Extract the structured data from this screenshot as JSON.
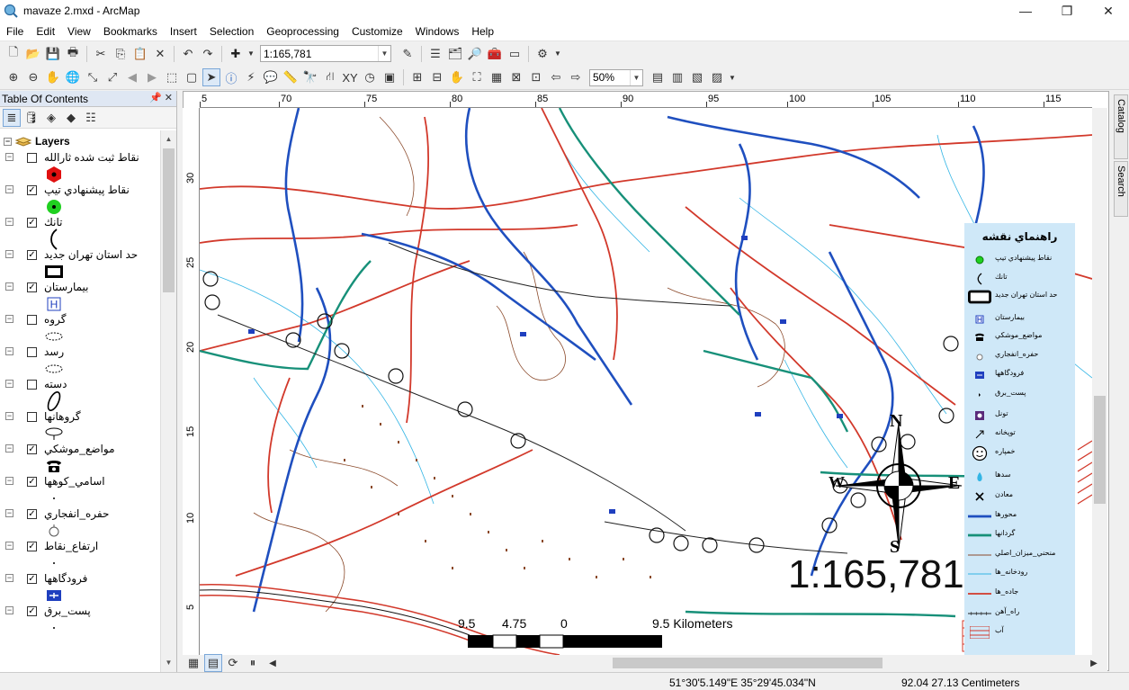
{
  "window": {
    "title": "mavaze 2.mxd - ArcMap",
    "minimize": "—",
    "maximize": "❐",
    "close": "✕"
  },
  "menu": [
    "File",
    "Edit",
    "View",
    "Bookmarks",
    "Insert",
    "Selection",
    "Geoprocessing",
    "Customize",
    "Windows",
    "Help"
  ],
  "toolbar": {
    "scale_value": "1:165,781",
    "zoom_value": "50%"
  },
  "toc": {
    "title": "Table Of Contents",
    "root": "Layers",
    "layers": [
      {
        "name": "نقاط ثبت شده ثارالله",
        "checked": false,
        "symbol": "red-hexagon"
      },
      {
        "name": "نقاط پيشنهادي تيپ",
        "checked": true,
        "symbol": "green-dot"
      },
      {
        "name": "تانك",
        "checked": true,
        "symbol": "paren"
      },
      {
        "name": "حد استان تهران جديد",
        "checked": true,
        "symbol": "black-rect"
      },
      {
        "name": "بيمارستان",
        "checked": true,
        "symbol": "hospital-h"
      },
      {
        "name": "گروه",
        "checked": false,
        "symbol": "ellipse-dashed"
      },
      {
        "name": "رسد",
        "checked": false,
        "symbol": "ellipse-dashed"
      },
      {
        "name": "دسته",
        "checked": false,
        "symbol": "ellipse-tilt"
      },
      {
        "name": "گروهانها",
        "checked": false,
        "symbol": "ellipse-tail"
      },
      {
        "name": "مواضع_موشكي",
        "checked": true,
        "symbol": "phone"
      },
      {
        "name": "اسامي_كوهها",
        "checked": true,
        "symbol": "dot"
      },
      {
        "name": "حفره_انفجاري",
        "checked": true,
        "symbol": "circle-small"
      },
      {
        "name": "ارتفاع_نقاط",
        "checked": true,
        "symbol": "dot"
      },
      {
        "name": "فرودگاهها",
        "checked": true,
        "symbol": "airport"
      },
      {
        "name": "پست_برق",
        "checked": true,
        "symbol": "dot"
      }
    ]
  },
  "ruler": {
    "top": [
      "5",
      "70",
      "75",
      "80",
      "85",
      "90",
      "95",
      "100",
      "105",
      "110",
      "115"
    ],
    "left": [
      "30",
      "25",
      "20",
      "15",
      "10",
      "5"
    ]
  },
  "map": {
    "scale_text": "1:165,781",
    "scalebar_labels": [
      "9.5",
      "4.75",
      "0",
      "9.5 Kilometers"
    ],
    "compass": {
      "n": "N",
      "s": "S",
      "e": "E",
      "w": "W"
    }
  },
  "legend": {
    "title": "راهنماي نقشه",
    "items": [
      {
        "label": "نقاط پيشنهادي تيپ",
        "symbol": "green-dot"
      },
      {
        "label": "تانك",
        "symbol": "paren"
      },
      {
        "label": "حد استان تهران جديد",
        "symbol": "black-rect"
      },
      {
        "label": "بيمارستان",
        "symbol": "blue-h"
      },
      {
        "label": "مواضع_موشكي",
        "symbol": "phone"
      },
      {
        "label": "حفره_انفجاري",
        "symbol": "circle-small"
      },
      {
        "label": "فرودگاهها",
        "symbol": "airport"
      },
      {
        "label": "پست_برق",
        "symbol": "dot"
      },
      {
        "label": "تونل",
        "symbol": "tunnel"
      },
      {
        "label": "توپخانه",
        "symbol": "arrow"
      },
      {
        "label": "خمپاره",
        "symbol": "smiley"
      },
      {
        "label": "سدها",
        "symbol": "dam"
      },
      {
        "label": "معادن",
        "symbol": "mine"
      },
      {
        "label": "محورها",
        "symbol": "line-blue"
      },
      {
        "label": "گردانها",
        "symbol": "line-teal"
      },
      {
        "label": "منحني_ميزان_اصلي",
        "symbol": "line-brown"
      },
      {
        "label": "رودخانه_ها",
        "symbol": "line-cyan"
      },
      {
        "label": "جاده_ها",
        "symbol": "line-red"
      },
      {
        "label": "راه_آهن",
        "symbol": "line-rail"
      },
      {
        "label": "آب",
        "symbol": "hatch"
      }
    ]
  },
  "sidebar_tabs": [
    "Catalog",
    "Search"
  ],
  "status": {
    "coords": "51°30'5.149\"E  35°29'45.034\"N",
    "page": "92.04  27.13 Centimeters"
  },
  "colors": {
    "road": "#d2392b",
    "axis": "#1f4fbf",
    "river": "#33b5e5",
    "battalion": "#179079",
    "contour": "#8b4a2b",
    "legend_bg": "#cfe8f8"
  }
}
